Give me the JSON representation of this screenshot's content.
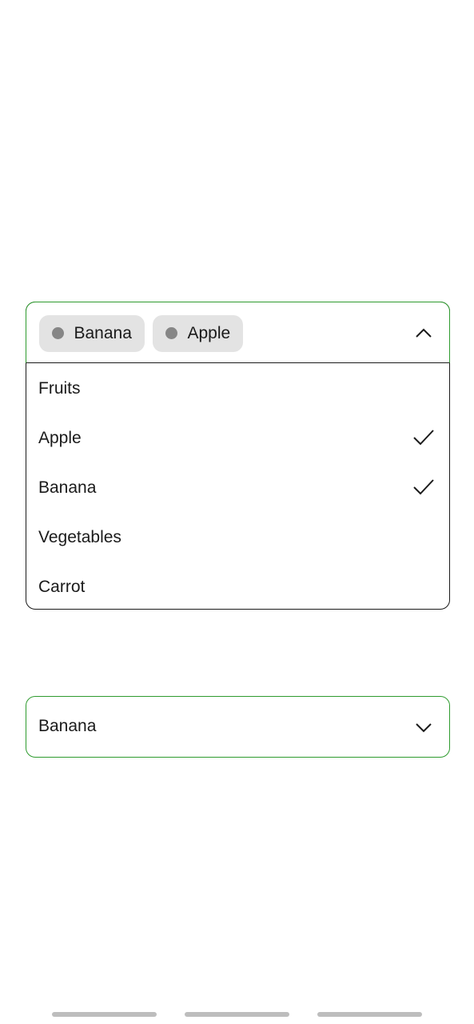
{
  "multi_select": {
    "chips": [
      {
        "label": "Banana"
      },
      {
        "label": "Apple"
      }
    ],
    "expanded": true,
    "chevron_icon": "chevron-up-icon",
    "options": [
      {
        "label": "Fruits",
        "selected": false
      },
      {
        "label": "Apple",
        "selected": true
      },
      {
        "label": "Banana",
        "selected": true
      },
      {
        "label": "Vegetables",
        "selected": false
      },
      {
        "label": "Carrot",
        "selected": false
      }
    ]
  },
  "single_select": {
    "value": "Banana",
    "expanded": false,
    "chevron_icon": "chevron-down-icon"
  },
  "colors": {
    "focus_border": "#2e9b2e",
    "chip_background": "#e3e3e3",
    "chip_dot": "#868686",
    "text": "#1a1a1a"
  }
}
